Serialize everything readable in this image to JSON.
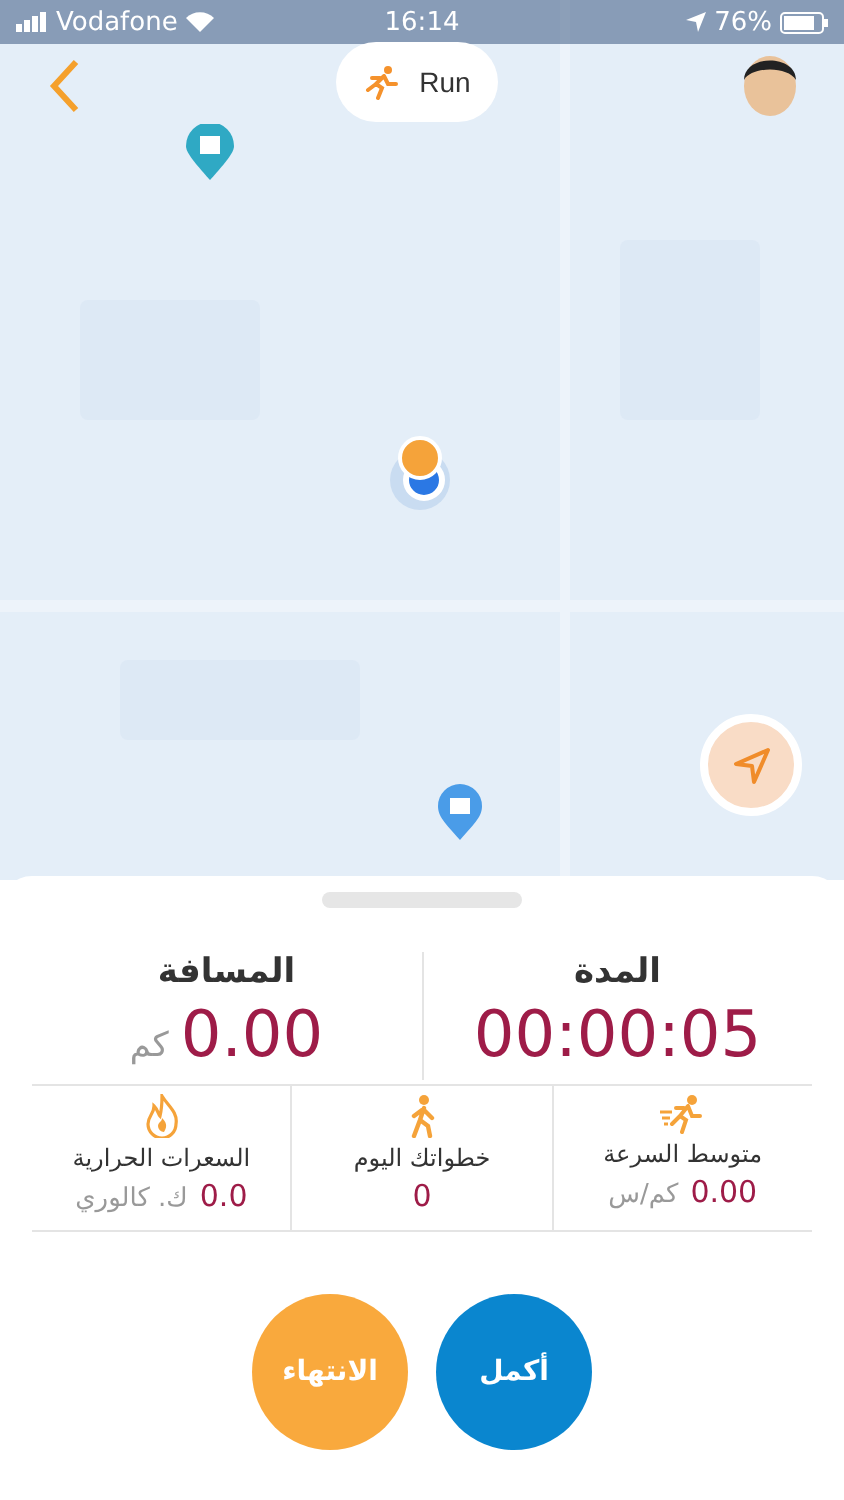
{
  "status_bar": {
    "carrier": "Vodafone",
    "time": "16:14",
    "battery": "76%"
  },
  "activity_button": {
    "label": "Run"
  },
  "summary": [
    {
      "label": "المدة",
      "value": "00:00:05"
    },
    {
      "label": "المسافة",
      "value": "0.00",
      "unit": "كم"
    }
  ],
  "metrics": [
    {
      "kind": "speed",
      "label": "متوسط السرعة",
      "value": "0.00",
      "unit": "كم/س"
    },
    {
      "kind": "steps",
      "label": "خطواتك اليوم",
      "value": "0"
    },
    {
      "kind": "calories",
      "label": "السعرات الحرارية",
      "value": "0.0",
      "unit": "ك. كالوري"
    }
  ],
  "buttons": [
    {
      "kind": "continue",
      "label": "أكمل"
    },
    {
      "kind": "finish",
      "label": "الانتهاء"
    }
  ]
}
